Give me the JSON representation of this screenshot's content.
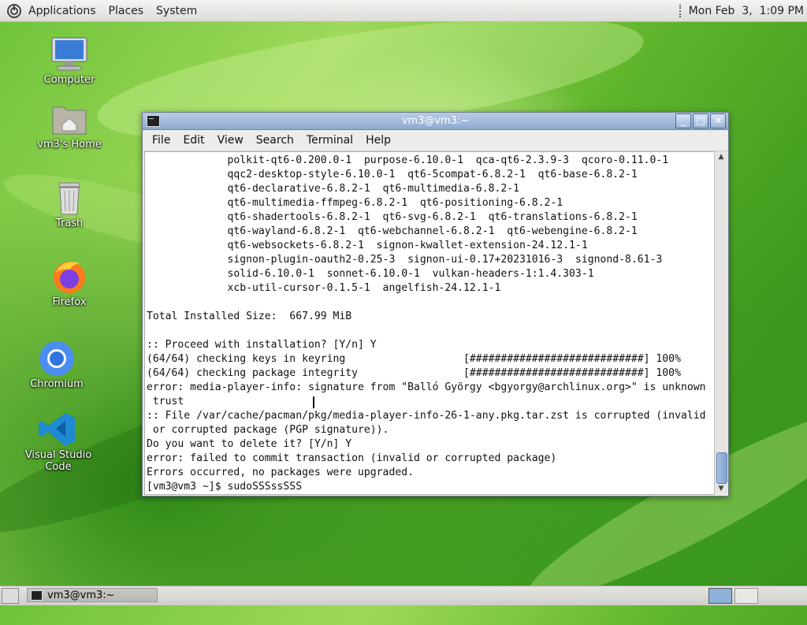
{
  "top_panel": {
    "menus": [
      "Applications",
      "Places",
      "System"
    ],
    "clock": "Mon Feb  3,  1:09 PM"
  },
  "desktop_icons": [
    {
      "label": "Computer",
      "icon": "computer-icon"
    },
    {
      "label": "vm3's Home",
      "icon": "home-folder-icon"
    },
    {
      "label": "Trash",
      "icon": "trash-icon"
    },
    {
      "label": "Firefox",
      "icon": "firefox-icon"
    },
    {
      "label": "Chromium",
      "icon": "chromium-icon"
    },
    {
      "label": "Visual Studio Code",
      "icon": "vscode-icon"
    }
  ],
  "window": {
    "title": "vm3@vm3:~",
    "menu": [
      "File",
      "Edit",
      "View",
      "Search",
      "Terminal",
      "Help"
    ],
    "terminal_lines": [
      "             polkit-qt6-0.200.0-1  purpose-6.10.0-1  qca-qt6-2.3.9-3  qcoro-0.11.0-1",
      "             qqc2-desktop-style-6.10.0-1  qt6-5compat-6.8.2-1  qt6-base-6.8.2-1",
      "             qt6-declarative-6.8.2-1  qt6-multimedia-6.8.2-1",
      "             qt6-multimedia-ffmpeg-6.8.2-1  qt6-positioning-6.8.2-1",
      "             qt6-shadertools-6.8.2-1  qt6-svg-6.8.2-1  qt6-translations-6.8.2-1",
      "             qt6-wayland-6.8.2-1  qt6-webchannel-6.8.2-1  qt6-webengine-6.8.2-1",
      "             qt6-websockets-6.8.2-1  signon-kwallet-extension-24.12.1-1",
      "             signon-plugin-oauth2-0.25-3  signon-ui-0.17+20231016-3  signond-8.61-3",
      "             solid-6.10.0-1  sonnet-6.10.0-1  vulkan-headers-1:1.4.303-1",
      "             xcb-util-cursor-0.1.5-1  angelfish-24.12.1-1",
      "",
      "Total Installed Size:  667.99 MiB",
      "",
      ":: Proceed with installation? [Y/n] Y",
      "(64/64) checking keys in keyring                   [############################] 100%",
      "(64/64) checking package integrity                 [############################] 100%",
      "error: media-player-info: signature from \"Balló György <bgyorgy@archlinux.org>\" is unknown",
      " trust",
      ":: File /var/cache/pacman/pkg/media-player-info-26-1-any.pkg.tar.zst is corrupted (invalid",
      " or corrupted package (PGP signature)).",
      "Do you want to delete it? [Y/n] Y",
      "error: failed to commit transaction (invalid or corrupted package)",
      "Errors occurred, no packages were upgraded.",
      "[vm3@vm3 ~]$ sudoSSSssSSS"
    ]
  },
  "taskbar": {
    "task_label": "vm3@vm3:~"
  }
}
